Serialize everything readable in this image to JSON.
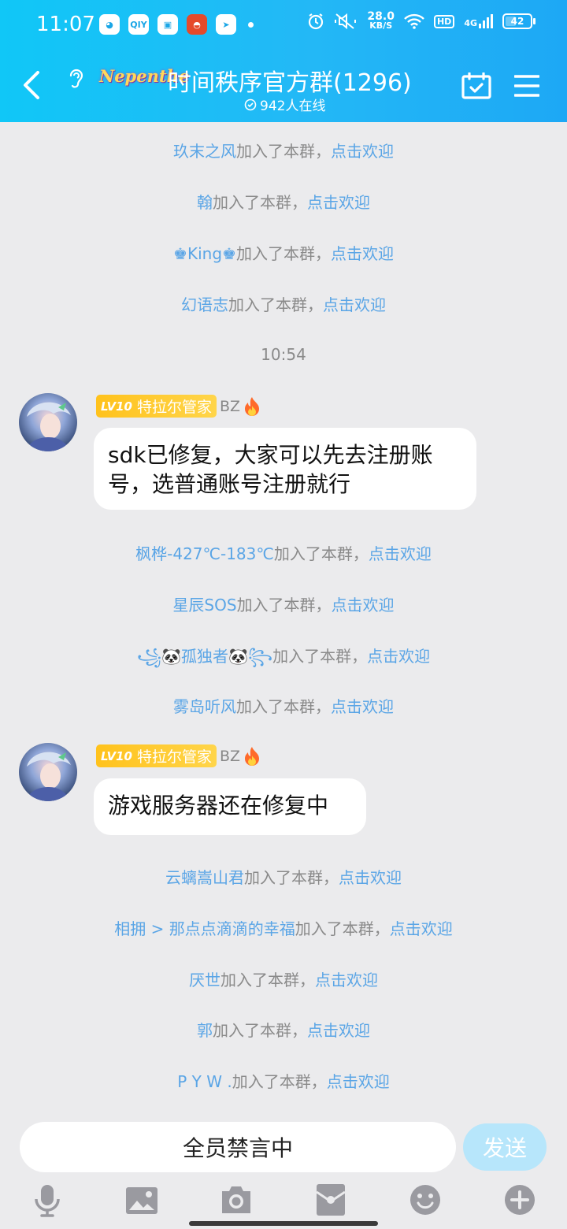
{
  "status_bar": {
    "time": "11:07",
    "app_icons": [
      "QQ浏览器",
      "QIY",
      "多任务",
      "拼多多",
      "飞书"
    ],
    "speed_value": "28.0",
    "speed_unit": "KB/S",
    "hd": "HD",
    "network": "4G",
    "battery": "42",
    "battery_level": 0.42
  },
  "header": {
    "logo_text": "Nepenthe",
    "title": "时间秩序官方群(1296)",
    "online": "942人在线",
    "accent": "#1db8f6"
  },
  "messages": {
    "sys1": {
      "name": "玖末之风",
      "suffix": "加入了本群，",
      "action": "点击欢迎"
    },
    "sys2": {
      "name": "翰",
      "suffix": "加入了本群，",
      "action": "点击欢迎"
    },
    "sys3": {
      "name": "♚King♚",
      "suffix": "加入了本群，",
      "action": "点击欢迎"
    },
    "sys4": {
      "name": "幻语志",
      "suffix": "加入了本群，",
      "action": "点击欢迎"
    },
    "timestamp": "10:54",
    "chat1": {
      "level": "LV10",
      "title": "特拉尔管家",
      "role": "BZ",
      "text": "sdk已修复，大家可以先去注册账号，选普通账号注册就行"
    },
    "sys5": {
      "name": "枫桦-427℃-183℃",
      "suffix": "加入了本群，",
      "action": "点击欢迎"
    },
    "sys6": {
      "name": "星辰SOS",
      "suffix": "加入了本群，",
      "action": "点击欢迎"
    },
    "sys7": {
      "name": "꧁🐼孤独者🐼꧂",
      "suffix": "加入了本群，",
      "action": "点击欢迎"
    },
    "sys8": {
      "name": "雾岛听风",
      "suffix": "加入了本群，",
      "action": "点击欢迎"
    },
    "chat2": {
      "level": "LV10",
      "title": "特拉尔管家",
      "role": "BZ",
      "text": "游戏服务器还在修复中"
    },
    "sys9": {
      "name": "云螭嵩山君",
      "suffix": "加入了本群，",
      "action": "点击欢迎"
    },
    "sys10": {
      "name": "相拥 > 那点点滴滴的幸福",
      "suffix": "加入了本群，",
      "action": "点击欢迎"
    },
    "sys11": {
      "name": "厌世",
      "suffix": "加入了本群，",
      "action": "点击欢迎"
    },
    "sys12": {
      "name": "郭",
      "suffix": "加入了本群，",
      "action": "点击欢迎"
    },
    "sys13": {
      "name": "P Y W .",
      "suffix": "加入了本群，",
      "action": "点击欢迎"
    }
  },
  "input": {
    "placeholder": "全员禁言中",
    "send_label": "发送"
  },
  "toolbar": [
    "mic-icon",
    "image-icon",
    "camera-icon",
    "red-packet-icon",
    "emoji-icon",
    "plus-icon"
  ]
}
